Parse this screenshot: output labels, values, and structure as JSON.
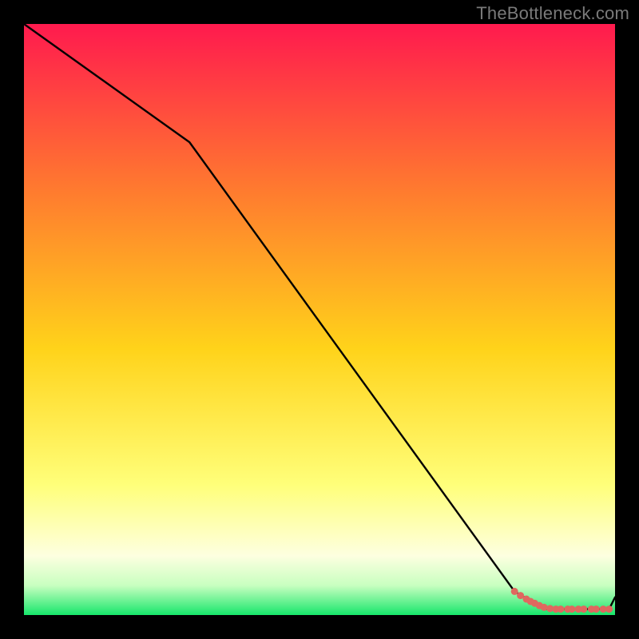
{
  "watermark": "TheBottleneck.com",
  "colors": {
    "background": "#000000",
    "gradient_top": "#ff1a4e",
    "gradient_upper_mid": "#ff7a2f",
    "gradient_mid": "#ffd31a",
    "gradient_lower": "#ffff7a",
    "gradient_pale": "#fdffe0",
    "gradient_green": "#17e66b",
    "line": "#000000",
    "marker": "#e0685f"
  },
  "chart_data": {
    "type": "line",
    "title": "",
    "xlabel": "",
    "ylabel": "",
    "xlim": [
      0,
      100
    ],
    "ylim": [
      0,
      100
    ],
    "series": [
      {
        "name": "bottleneck-curve",
        "x": [
          0,
          28,
          83,
          88,
          94,
          99,
          100
        ],
        "values": [
          100,
          80,
          4,
          1,
          1,
          1,
          3
        ]
      }
    ],
    "markers": {
      "name": "highlighted-points",
      "x": [
        83,
        84,
        85,
        85.7,
        86.4,
        87.2,
        88,
        89,
        90,
        90.8,
        92,
        92.7,
        93.8,
        94.7,
        96,
        96.8,
        98,
        99
      ],
      "values": [
        4,
        3.3,
        2.7,
        2.3,
        2.0,
        1.6,
        1.3,
        1.1,
        1.0,
        1.0,
        1.0,
        1.0,
        1.0,
        1.0,
        1.0,
        1.0,
        1.0,
        1.0
      ]
    }
  }
}
